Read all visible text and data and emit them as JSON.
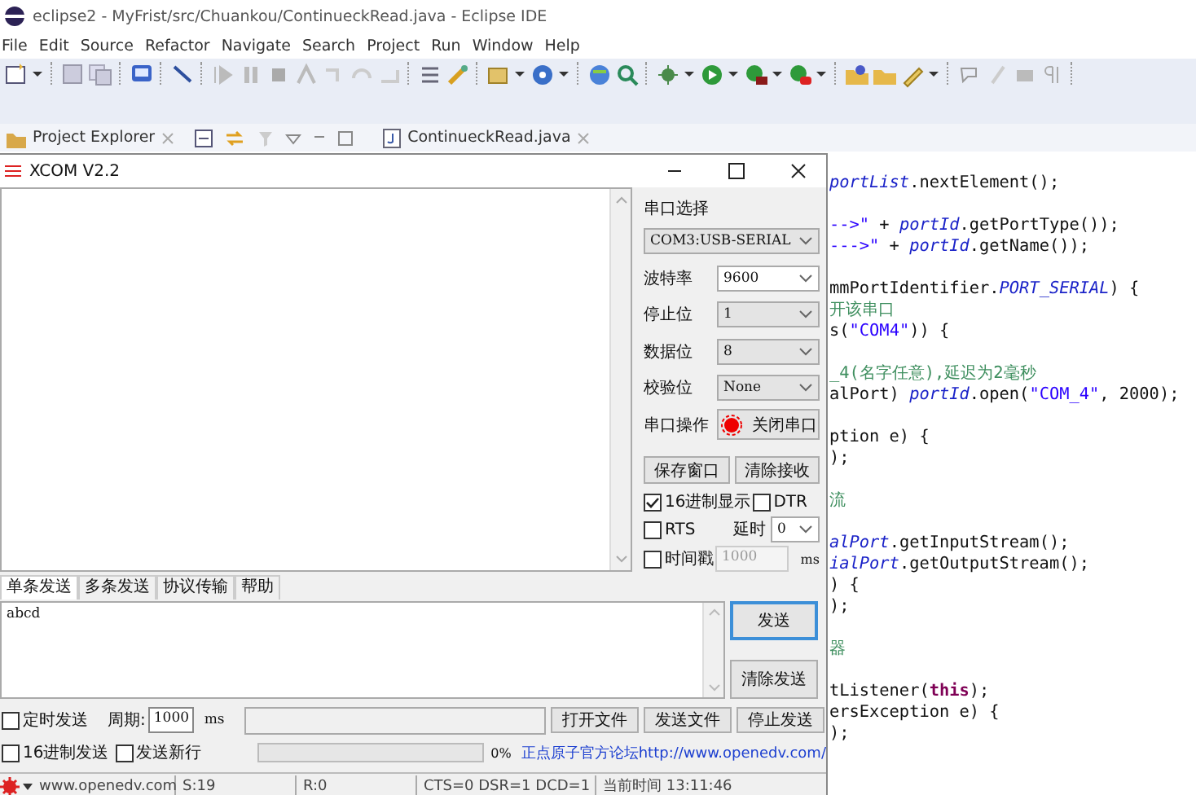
{
  "window": {
    "title": "eclipse2 - MyFrist/src/Chuankou/ContinueckRead.java - Eclipse IDE"
  },
  "menu": [
    "File",
    "Edit",
    "Source",
    "Refactor",
    "Navigate",
    "Search",
    "Project",
    "Run",
    "Window",
    "Help"
  ],
  "view_tab": {
    "label": "Project Explorer"
  },
  "editor_tab": {
    "label": "ContinueckRead.java"
  },
  "editor": {
    "blocks": [
      [
        [
          {
            "text": "portList",
            "kind": "field"
          },
          {
            "text": ".nextElement();",
            "kind": "plain"
          }
        ]
      ],
      [
        [
          {
            "text": "-->\"",
            "kind": "string"
          },
          {
            "text": " + ",
            "kind": "plain"
          },
          {
            "text": "portId",
            "kind": "field"
          },
          {
            "text": ".getPortType());",
            "kind": "plain"
          }
        ],
        [
          {
            "text": "--->\"",
            "kind": "string"
          },
          {
            "text": " + ",
            "kind": "plain"
          },
          {
            "text": "portId",
            "kind": "field"
          },
          {
            "text": ".getName());",
            "kind": "plain"
          }
        ]
      ],
      [
        [
          {
            "text": "mmPortIdentifier.",
            "kind": "plain"
          },
          {
            "text": "PORT_SERIAL",
            "kind": "field"
          },
          {
            "text": ") {",
            "kind": "plain"
          }
        ],
        [
          {
            "text": "开该串口",
            "kind": "comment"
          }
        ],
        [
          {
            "text": "s(",
            "kind": "plain"
          },
          {
            "text": "\"COM4\"",
            "kind": "string"
          },
          {
            "text": ")) {",
            "kind": "plain"
          }
        ]
      ],
      [
        [
          {
            "text": "_4(名字任意),延迟为2毫秒",
            "kind": "comment"
          }
        ],
        [
          {
            "text": "alPort) ",
            "kind": "plain"
          },
          {
            "text": "portId",
            "kind": "field"
          },
          {
            "text": ".open(",
            "kind": "plain"
          },
          {
            "text": "\"COM_4\"",
            "kind": "string"
          },
          {
            "text": ", 2000);",
            "kind": "plain"
          }
        ]
      ],
      [
        [
          {
            "text": "ption e) {",
            "kind": "plain"
          }
        ],
        [
          {
            "text": ");",
            "kind": "plain"
          }
        ]
      ],
      [
        [
          {
            "text": "流",
            "kind": "comment"
          }
        ]
      ],
      [
        [
          {
            "text": "alPort",
            "kind": "field"
          },
          {
            "text": ".getInputStream();",
            "kind": "plain"
          }
        ],
        [
          {
            "text": "ialPort",
            "kind": "field"
          },
          {
            "text": ".getOutputStream();",
            "kind": "plain"
          }
        ],
        [
          {
            "text": ") {",
            "kind": "plain"
          }
        ],
        [
          {
            "text": ");",
            "kind": "plain"
          }
        ]
      ],
      [
        [
          {
            "text": "器",
            "kind": "comment"
          }
        ]
      ],
      [
        [
          {
            "text": "tListener(",
            "kind": "plain"
          },
          {
            "text": "this",
            "kind": "keyword"
          },
          {
            "text": ");",
            "kind": "plain"
          }
        ],
        [
          {
            "text": "ersException e) {",
            "kind": "plain"
          }
        ],
        [
          {
            "text": ");",
            "kind": "plain"
          }
        ]
      ]
    ]
  },
  "xcom": {
    "title": "XCOM V2.2",
    "port_label": "串口选择",
    "port_select": {
      "value": "COM3:USB-SERIAL",
      "disabled": true
    },
    "settings": [
      {
        "label": "波特率",
        "value": "9600",
        "disabled": false
      },
      {
        "label": "停止位",
        "value": "1",
        "disabled": true
      },
      {
        "label": "数据位",
        "value": "8",
        "disabled": true
      },
      {
        "label": "校验位",
        "value": "None",
        "disabled": true
      }
    ],
    "port_action": {
      "label": "串口操作",
      "button": "关闭串口",
      "open": true
    },
    "receive_buttons": [
      "保存窗口",
      "清除接收"
    ],
    "options": [
      {
        "label": "16进制显示",
        "checked": true
      },
      {
        "label": "DTR",
        "checked": false
      },
      {
        "label": "RTS",
        "checked": false
      },
      {
        "label": "时间戳",
        "checked": false
      }
    ],
    "delay": {
      "label": "延时",
      "value": "0"
    },
    "timestamp_interval": {
      "value": "1000",
      "unit": "ms",
      "disabled": true
    },
    "send_tabs": [
      {
        "label": "单条发送",
        "selected": true
      },
      {
        "label": "多条发送",
        "selected": false
      },
      {
        "label": "协议传输",
        "selected": false
      },
      {
        "label": "帮助",
        "selected": false
      }
    ],
    "send_text": "abcd",
    "send_button": "发送",
    "clear_send_button": "清除发送",
    "timed_send": {
      "label": "定时发送",
      "checked": false
    },
    "period": {
      "label": "周期:",
      "value": "1000",
      "unit": "ms"
    },
    "file_buttons": [
      "打开文件",
      "发送文件",
      "停止发送"
    ],
    "hex_send": {
      "label": "16进制发送",
      "checked": false
    },
    "send_newline": {
      "label": "发送新行",
      "checked": false
    },
    "progress": {
      "level": 0,
      "reading": "0%"
    },
    "forum_link": "正点原子官方论坛http://www.openedv.com/",
    "status_bar": [
      "www.openedv.com",
      "S:19",
      "R:0",
      "CTS=0 DSR=1 DCD=1",
      "当前时间 13:11:46"
    ]
  }
}
